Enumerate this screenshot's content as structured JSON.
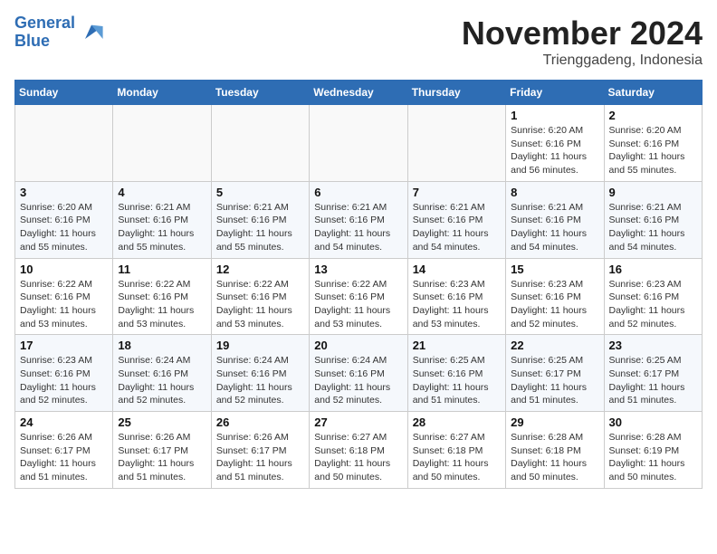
{
  "header": {
    "logo_line1": "General",
    "logo_line2": "Blue",
    "month": "November 2024",
    "location": "Trienggadeng, Indonesia"
  },
  "days_of_week": [
    "Sunday",
    "Monday",
    "Tuesday",
    "Wednesday",
    "Thursday",
    "Friday",
    "Saturday"
  ],
  "weeks": [
    [
      {
        "day": "",
        "info": ""
      },
      {
        "day": "",
        "info": ""
      },
      {
        "day": "",
        "info": ""
      },
      {
        "day": "",
        "info": ""
      },
      {
        "day": "",
        "info": ""
      },
      {
        "day": "1",
        "info": "Sunrise: 6:20 AM\nSunset: 6:16 PM\nDaylight: 11 hours and 56 minutes."
      },
      {
        "day": "2",
        "info": "Sunrise: 6:20 AM\nSunset: 6:16 PM\nDaylight: 11 hours and 55 minutes."
      }
    ],
    [
      {
        "day": "3",
        "info": "Sunrise: 6:20 AM\nSunset: 6:16 PM\nDaylight: 11 hours and 55 minutes."
      },
      {
        "day": "4",
        "info": "Sunrise: 6:21 AM\nSunset: 6:16 PM\nDaylight: 11 hours and 55 minutes."
      },
      {
        "day": "5",
        "info": "Sunrise: 6:21 AM\nSunset: 6:16 PM\nDaylight: 11 hours and 55 minutes."
      },
      {
        "day": "6",
        "info": "Sunrise: 6:21 AM\nSunset: 6:16 PM\nDaylight: 11 hours and 54 minutes."
      },
      {
        "day": "7",
        "info": "Sunrise: 6:21 AM\nSunset: 6:16 PM\nDaylight: 11 hours and 54 minutes."
      },
      {
        "day": "8",
        "info": "Sunrise: 6:21 AM\nSunset: 6:16 PM\nDaylight: 11 hours and 54 minutes."
      },
      {
        "day": "9",
        "info": "Sunrise: 6:21 AM\nSunset: 6:16 PM\nDaylight: 11 hours and 54 minutes."
      }
    ],
    [
      {
        "day": "10",
        "info": "Sunrise: 6:22 AM\nSunset: 6:16 PM\nDaylight: 11 hours and 53 minutes."
      },
      {
        "day": "11",
        "info": "Sunrise: 6:22 AM\nSunset: 6:16 PM\nDaylight: 11 hours and 53 minutes."
      },
      {
        "day": "12",
        "info": "Sunrise: 6:22 AM\nSunset: 6:16 PM\nDaylight: 11 hours and 53 minutes."
      },
      {
        "day": "13",
        "info": "Sunrise: 6:22 AM\nSunset: 6:16 PM\nDaylight: 11 hours and 53 minutes."
      },
      {
        "day": "14",
        "info": "Sunrise: 6:23 AM\nSunset: 6:16 PM\nDaylight: 11 hours and 53 minutes."
      },
      {
        "day": "15",
        "info": "Sunrise: 6:23 AM\nSunset: 6:16 PM\nDaylight: 11 hours and 52 minutes."
      },
      {
        "day": "16",
        "info": "Sunrise: 6:23 AM\nSunset: 6:16 PM\nDaylight: 11 hours and 52 minutes."
      }
    ],
    [
      {
        "day": "17",
        "info": "Sunrise: 6:23 AM\nSunset: 6:16 PM\nDaylight: 11 hours and 52 minutes."
      },
      {
        "day": "18",
        "info": "Sunrise: 6:24 AM\nSunset: 6:16 PM\nDaylight: 11 hours and 52 minutes."
      },
      {
        "day": "19",
        "info": "Sunrise: 6:24 AM\nSunset: 6:16 PM\nDaylight: 11 hours and 52 minutes."
      },
      {
        "day": "20",
        "info": "Sunrise: 6:24 AM\nSunset: 6:16 PM\nDaylight: 11 hours and 52 minutes."
      },
      {
        "day": "21",
        "info": "Sunrise: 6:25 AM\nSunset: 6:16 PM\nDaylight: 11 hours and 51 minutes."
      },
      {
        "day": "22",
        "info": "Sunrise: 6:25 AM\nSunset: 6:17 PM\nDaylight: 11 hours and 51 minutes."
      },
      {
        "day": "23",
        "info": "Sunrise: 6:25 AM\nSunset: 6:17 PM\nDaylight: 11 hours and 51 minutes."
      }
    ],
    [
      {
        "day": "24",
        "info": "Sunrise: 6:26 AM\nSunset: 6:17 PM\nDaylight: 11 hours and 51 minutes."
      },
      {
        "day": "25",
        "info": "Sunrise: 6:26 AM\nSunset: 6:17 PM\nDaylight: 11 hours and 51 minutes."
      },
      {
        "day": "26",
        "info": "Sunrise: 6:26 AM\nSunset: 6:17 PM\nDaylight: 11 hours and 51 minutes."
      },
      {
        "day": "27",
        "info": "Sunrise: 6:27 AM\nSunset: 6:18 PM\nDaylight: 11 hours and 50 minutes."
      },
      {
        "day": "28",
        "info": "Sunrise: 6:27 AM\nSunset: 6:18 PM\nDaylight: 11 hours and 50 minutes."
      },
      {
        "day": "29",
        "info": "Sunrise: 6:28 AM\nSunset: 6:18 PM\nDaylight: 11 hours and 50 minutes."
      },
      {
        "day": "30",
        "info": "Sunrise: 6:28 AM\nSunset: 6:19 PM\nDaylight: 11 hours and 50 minutes."
      }
    ]
  ]
}
